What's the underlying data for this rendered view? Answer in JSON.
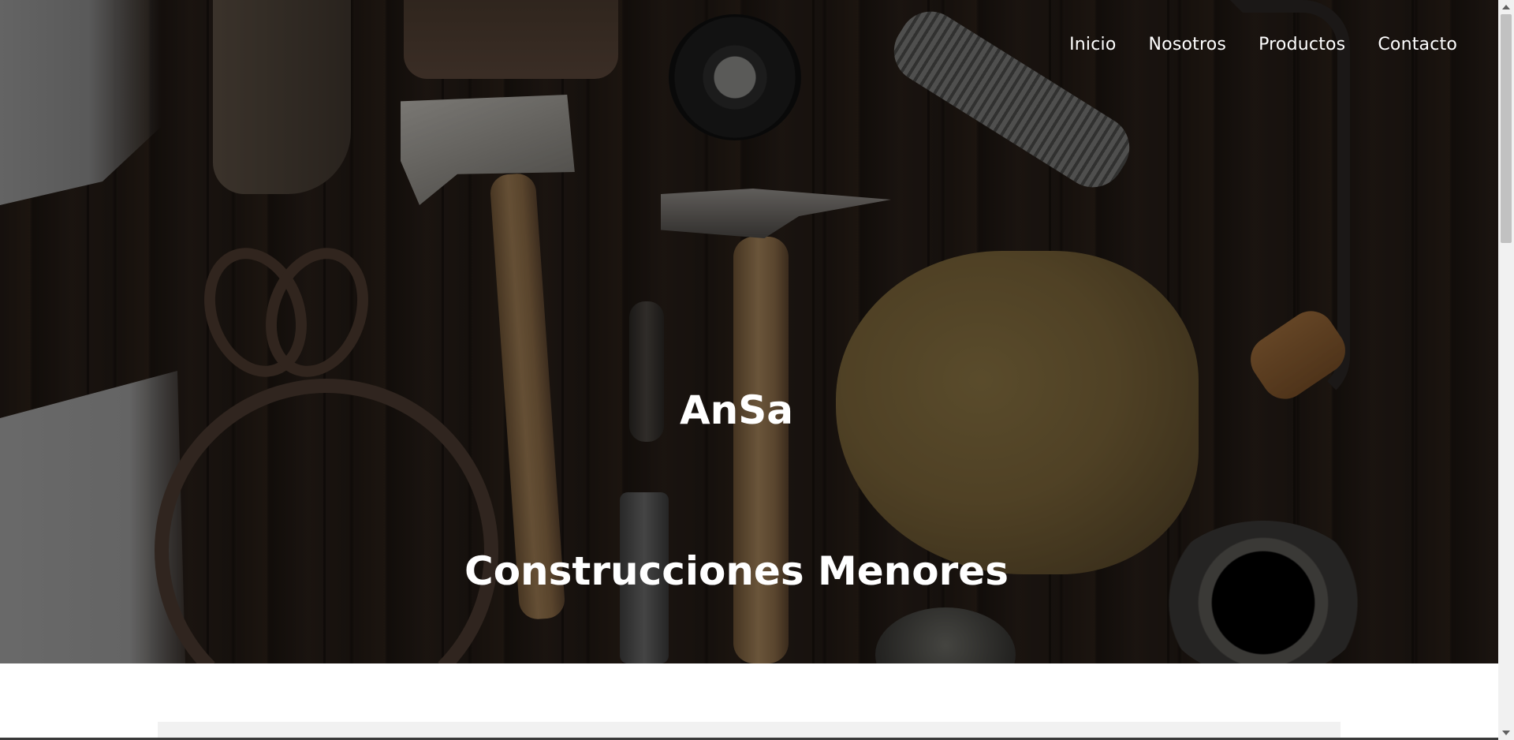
{
  "nav": {
    "items": [
      {
        "label": "Inicio"
      },
      {
        "label": "Nosotros"
      },
      {
        "label": "Productos"
      },
      {
        "label": "Contacto"
      }
    ]
  },
  "hero": {
    "title": "AnSa",
    "subtitle": "Construcciones Menores"
  },
  "colors": {
    "nav_text": "#ffffff",
    "hero_text": "#ffffff",
    "page_background": "#ffffff",
    "content_strip": "#f1f1f1"
  },
  "icons": {
    "scroll_up": "scroll-up-arrow-icon",
    "scroll_down": "scroll-down-arrow-icon"
  }
}
